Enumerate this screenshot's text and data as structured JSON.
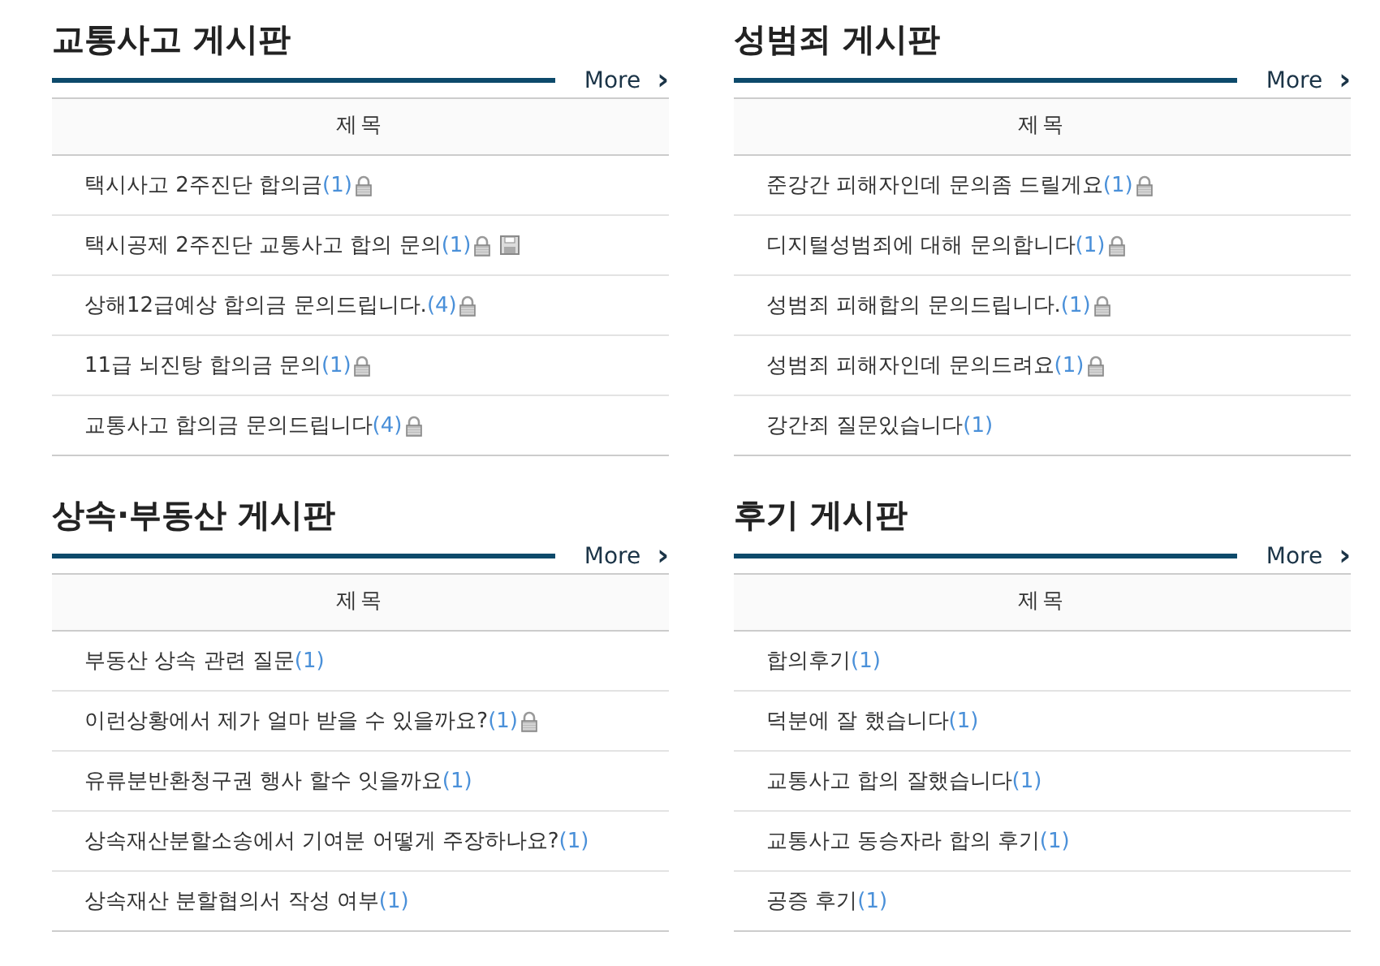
{
  "boards": [
    {
      "title": "교통사고 게시판",
      "more": "More",
      "chevron": "›",
      "column": "제목",
      "posts": [
        {
          "title": "택시사고 2주진단 합의금",
          "comments": "(1)",
          "locked": true,
          "attachment": false
        },
        {
          "title": "택시공제 2주진단 교통사고 합의 문의",
          "comments": "(1)",
          "locked": true,
          "attachment": true
        },
        {
          "title": "상해12급예상 합의금 문의드립니다.",
          "comments": "(4)",
          "locked": true,
          "attachment": false
        },
        {
          "title": "11급 뇌진탕 합의금 문의",
          "comments": "(1)",
          "locked": true,
          "attachment": false
        },
        {
          "title": "교통사고 합의금 문의드립니다",
          "comments": "(4)",
          "locked": true,
          "attachment": false
        }
      ]
    },
    {
      "title": "성범죄 게시판",
      "more": "More",
      "chevron": "›",
      "column": "제목",
      "posts": [
        {
          "title": "준강간 피해자인데 문의좀 드릴게요",
          "comments": "(1)",
          "locked": true,
          "attachment": false
        },
        {
          "title": "디지털성범죄에 대해 문의합니다",
          "comments": "(1)",
          "locked": true,
          "attachment": false
        },
        {
          "title": "성범죄 피해합의 문의드립니다.",
          "comments": "(1)",
          "locked": true,
          "attachment": false
        },
        {
          "title": "성범죄 피해자인데 문의드려요",
          "comments": "(1)",
          "locked": true,
          "attachment": false
        },
        {
          "title": "강간죄 질문있습니다",
          "comments": "(1)",
          "locked": false,
          "attachment": false
        }
      ]
    },
    {
      "title": "상속·부동산 게시판",
      "more": "More",
      "chevron": "›",
      "column": "제목",
      "posts": [
        {
          "title": "부동산 상속 관련 질문",
          "comments": "(1)",
          "locked": false,
          "attachment": false
        },
        {
          "title": "이런상황에서 제가 얼마 받을 수 있을까요?",
          "comments": "(1)",
          "locked": true,
          "attachment": false
        },
        {
          "title": "유류분반환청구권 행사 할수 잇을까요",
          "comments": "(1)",
          "locked": false,
          "attachment": false
        },
        {
          "title": "상속재산분할소송에서 기여분 어떻게 주장하나요?",
          "comments": "(1)",
          "locked": false,
          "attachment": false
        },
        {
          "title": "상속재산 분할협의서 작성 여부",
          "comments": "(1)",
          "locked": false,
          "attachment": false
        }
      ]
    },
    {
      "title": "후기 게시판",
      "more": "More",
      "chevron": "›",
      "column": "제목",
      "posts": [
        {
          "title": "합의후기",
          "comments": "(1)",
          "locked": false,
          "attachment": false
        },
        {
          "title": "덕분에 잘 했습니다",
          "comments": "(1)",
          "locked": false,
          "attachment": false
        },
        {
          "title": "교통사고 합의 잘했습니다",
          "comments": "(1)",
          "locked": false,
          "attachment": false
        },
        {
          "title": "교통사고 동승자라 합의 후기",
          "comments": "(1)",
          "locked": false,
          "attachment": false
        },
        {
          "title": "공증 후기",
          "comments": "(1)",
          "locked": false,
          "attachment": false
        }
      ]
    }
  ]
}
